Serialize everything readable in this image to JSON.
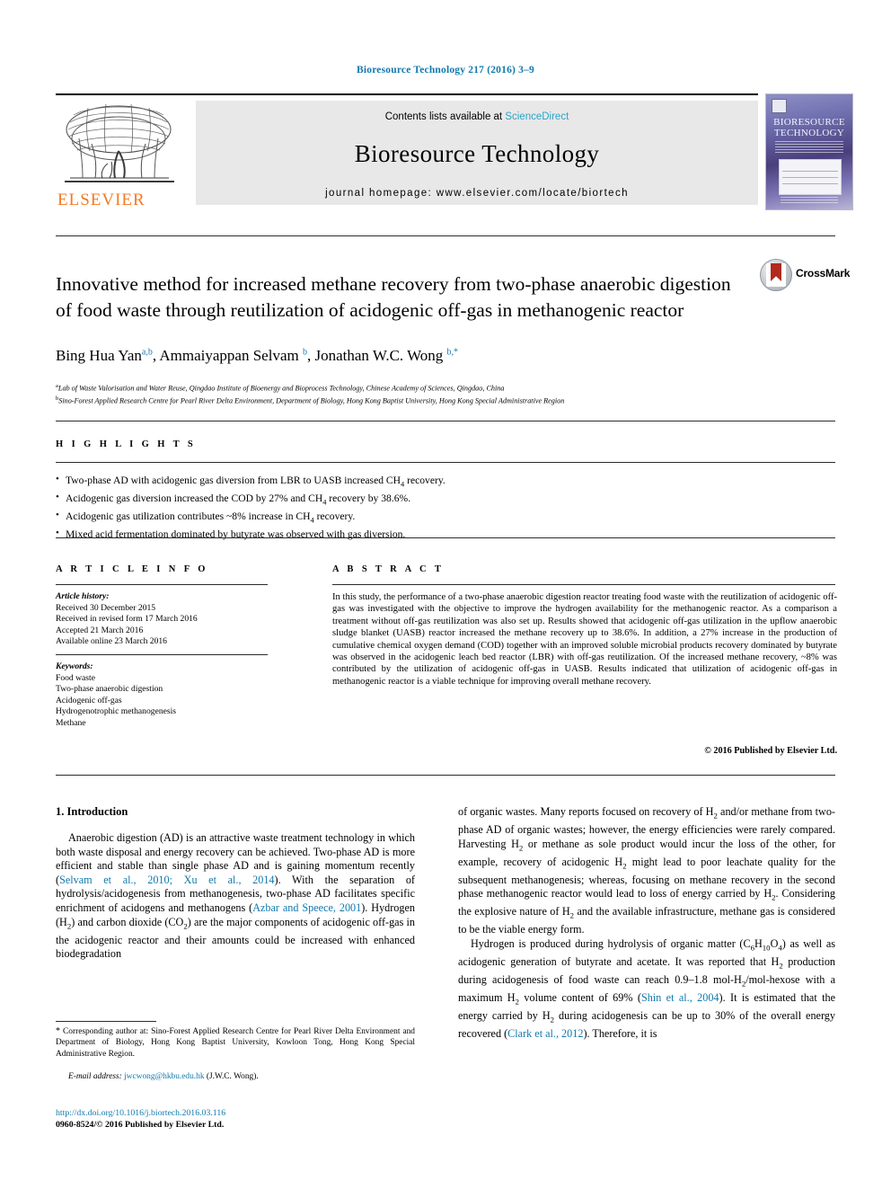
{
  "running_head": "Bioresource Technology 217 (2016) 3–9",
  "masthead": {
    "contents_prefix": "Contents lists available at ",
    "sciencedirect": "ScienceDirect",
    "journal_name": "Bioresource Technology",
    "homepage": "journal homepage: www.elsevier.com/locate/biortech",
    "publisher_wordmark": "ELSEVIER",
    "cover_title_line1": "BIORESOURCE",
    "cover_title_line2": "TECHNOLOGY"
  },
  "article": {
    "title": "Innovative method for increased methane recovery from two-phase anaerobic digestion of food waste through reutilization of acidogenic off-gas in methanogenic reactor",
    "crossmark_label": "CrossMark",
    "authors_html": "Bing Hua Yan<sup>a,b</sup>, Ammaiyappan Selvam <sup>b</sup>, Jonathan W.C. Wong <sup>b,*</sup>",
    "affiliations": [
      {
        "marker": "a",
        "text": "Lab of Waste Valorisation and Water Reuse, Qingdao Institute of Bioenergy and Bioprocess Technology, Chinese Academy of Sciences, Qingdao, China"
      },
      {
        "marker": "b",
        "text": "Sino-Forest Applied Research Centre for Pearl River Delta Environment, Department of Biology, Hong Kong Baptist University, Hong Kong Special Administrative Region"
      }
    ]
  },
  "highlights": {
    "heading": "H I G H L I G H T S",
    "items_html": [
      "Two-phase AD with acidogenic gas diversion from LBR to UASB increased CH<sub>4</sub> recovery.",
      "Acidogenic gas diversion increased the COD by 27% and CH<sub>4</sub> recovery by 38.6%.",
      "Acidogenic gas utilization contributes ~8% increase in CH<sub>4</sub> recovery.",
      "Mixed acid fermentation dominated by butyrate was observed with gas diversion."
    ]
  },
  "article_info": {
    "heading": "A R T I C L E  I N F O",
    "history_label": "Article history:",
    "history": [
      "Received 30 December 2015",
      "Received in revised form 17 March 2016",
      "Accepted 21 March 2016",
      "Available online 23 March 2016"
    ],
    "keywords_label": "Keywords:",
    "keywords": [
      "Food waste",
      "Two-phase anaerobic digestion",
      "Acidogenic off-gas",
      "Hydrogenotrophic methanogenesis",
      "Methane"
    ]
  },
  "abstract": {
    "heading": "A B S T R A C T",
    "text": "In this study, the performance of a two-phase anaerobic digestion reactor treating food waste with the reutilization of acidogenic off-gas was investigated with the objective to improve the hydrogen availability for the methanogenic reactor. As a comparison a treatment without off-gas reutilization was also set up. Results showed that acidogenic off-gas utilization in the upflow anaerobic sludge blanket (UASB) reactor increased the methane recovery up to 38.6%. In addition, a 27% increase in the production of cumulative chemical oxygen demand (COD) together with an improved soluble microbial products recovery dominated by butyrate was observed in the acidogenic leach bed reactor (LBR) with off-gas reutilization. Of the increased methane recovery, ~8% was contributed by the utilization of acidogenic off-gas in UASB. Results indicated that utilization of acidogenic off-gas in methanogenic reactor is a viable technique for improving overall methane recovery.",
    "copyright": "© 2016 Published by Elsevier Ltd."
  },
  "introduction": {
    "heading": "1. Introduction",
    "left_paragraph_html": "Anaerobic digestion (AD) is an attractive waste treatment technology in which both waste disposal and energy recovery can be achieved. Two-phase AD is more efficient and stable than single phase AD and is gaining momentum recently (<span class=\"ref\">Selvam et al., 2010; Xu et al., 2014</span>). With the separation of hydrolysis/acidogenesis from methanogenesis, two-phase AD facilitates specific enrichment of acidogens and methanogens (<span class=\"ref\">Azbar and Speece, 2001</span>). Hydrogen (H<sub>2</sub>) and carbon dioxide (CO<sub>2</sub>) are the major components of acidogenic off-gas in the acidogenic reactor and their amounts could be increased with enhanced biodegradation",
    "right_paragraph1_html": "of organic wastes. Many reports focused on recovery of H<sub>2</sub> and/or methane from two-phase AD of organic wastes; however, the energy efficiencies were rarely compared. Harvesting H<sub>2</sub> or methane as sole product would incur the loss of the other, for example, recovery of acidogenic H<sub>2</sub> might lead to poor leachate quality for the subsequent methanogenesis; whereas, focusing on methane recovery in the second phase methanogenic reactor would lead to loss of energy carried by H<sub>2</sub>. Considering the explosive nature of H<sub>2</sub> and the available infrastructure, methane gas is considered to be the viable energy form.",
    "right_paragraph2_html": "Hydrogen is produced during hydrolysis of organic matter (C<sub>6</sub>H<sub>10</sub>O<sub>4</sub>) as well as acidogenic generation of butyrate and acetate. It was reported that H<sub>2</sub> production during acidogenesis of food waste can reach 0.9–1.8 mol-H<sub>2</sub>/mol-hexose with a maximum H<sub>2</sub> volume content of 69% (<span class=\"ref\">Shin et al., 2004</span>). It is estimated that the energy carried by H<sub>2</sub> during acidogenesis can be up to 30% of the overall energy recovered (<span class=\"ref\">Clark et al., 2012</span>). Therefore, it is"
  },
  "footer": {
    "corresponding_html": "<span class=\"star\">*</span> Corresponding author at: Sino-Forest Applied Research Centre for Pearl River Delta Environment and Department of Biology, Hong Kong Baptist University, Kowloon Tong, Hong Kong Special Administrative Region.",
    "email_label": "E-mail address:",
    "email": "jwcwong@hkbu.edu.hk",
    "email_owner": "(J.W.C. Wong).",
    "doi": "http://dx.doi.org/10.1016/j.biortech.2016.03.116",
    "issn_line": "0960-8524/© 2016 Published by Elsevier Ltd."
  },
  "colors": {
    "link_blue": "#1179ad",
    "sciencedirect_blue": "#2ea3c9",
    "elsevier_orange": "#f47920",
    "masthead_gray": "#e8e8e8"
  }
}
